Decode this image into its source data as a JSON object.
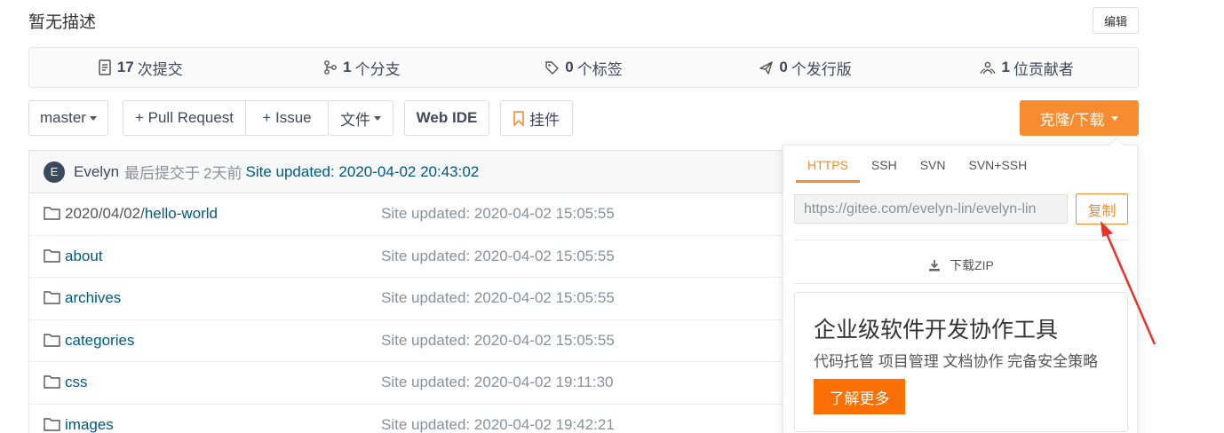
{
  "repo": {
    "description": "暂无描述",
    "edit_label": "编辑"
  },
  "stats": [
    {
      "icon": "commits-icon",
      "count": "17",
      "label": "次提交"
    },
    {
      "icon": "branch-icon",
      "count": "1",
      "label": "个分支"
    },
    {
      "icon": "tag-icon",
      "count": "0",
      "label": "个标签"
    },
    {
      "icon": "release-icon",
      "count": "0",
      "label": "个发行版"
    },
    {
      "icon": "contributors-icon",
      "count": "1",
      "label": "位贡献者"
    }
  ],
  "toolbar": {
    "branch": "master",
    "pull_request": "+ Pull Request",
    "issue": "+ Issue",
    "files": "文件",
    "web_ide": "Web IDE",
    "widget": "挂件",
    "clone": "克隆/下载"
  },
  "commit": {
    "avatar_letter": "E",
    "author": "Evelyn",
    "prefix": "最后提交于",
    "time": "2天前",
    "message": "Site updated: 2020-04-02 20:43:02"
  },
  "files": [
    {
      "prefix": "2020/04/02/",
      "name": "hello-world",
      "message": "Site updated: 2020-04-02 15:05:55"
    },
    {
      "prefix": "",
      "name": "about",
      "message": "Site updated: 2020-04-02 15:05:55"
    },
    {
      "prefix": "",
      "name": "archives",
      "message": "Site updated: 2020-04-02 15:05:55"
    },
    {
      "prefix": "",
      "name": "categories",
      "message": "Site updated: 2020-04-02 15:05:55"
    },
    {
      "prefix": "",
      "name": "css",
      "message": "Site updated: 2020-04-02 19:11:30"
    },
    {
      "prefix": "",
      "name": "images",
      "message": "Site updated: 2020-04-02 19:42:21"
    }
  ],
  "clone_panel": {
    "tabs": [
      "HTTPS",
      "SSH",
      "SVN",
      "SVN+SSH"
    ],
    "active_tab": "HTTPS",
    "url": "https://gitee.com/evelyn-lin/evelyn-lin",
    "copy_label": "复制",
    "zip_label": "下载ZIP",
    "promo_title": "企业级软件开发协作工具",
    "promo_subtitle": "代码托管 项目管理 文档协作 完备安全策略",
    "promo_button": "了解更多"
  },
  "colors": {
    "accent": "#f68c2f",
    "link": "#005980",
    "promo_button": "#fb6f04",
    "annotation_arrow": "#e8322b"
  }
}
